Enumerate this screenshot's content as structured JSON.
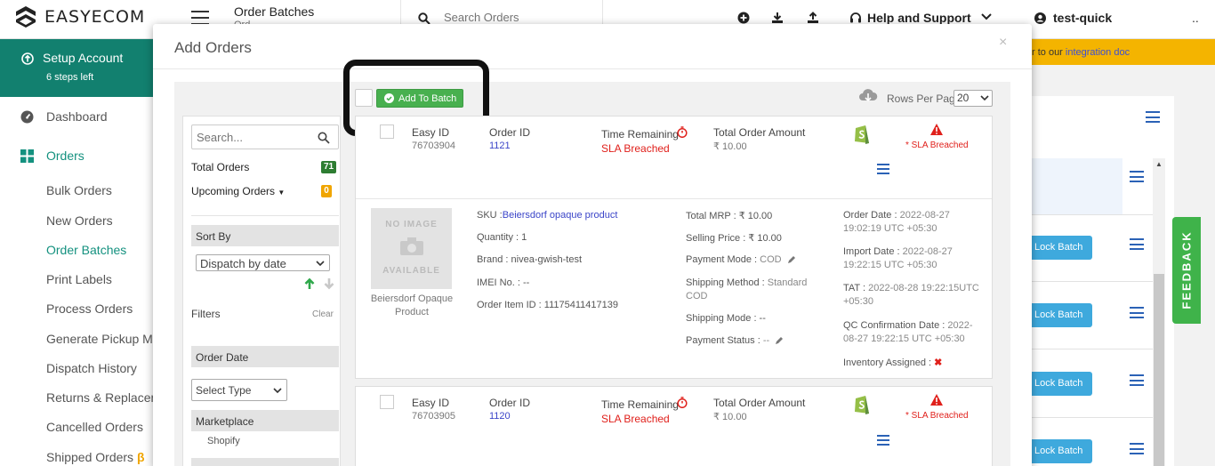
{
  "header": {
    "brand": "EASYECOM",
    "page_title": "Order Batches",
    "page_sub": "Ord",
    "search_placeholder": "Search Orders",
    "help_label": "Help and Support",
    "user_name": "test-quick",
    "more": "..",
    "icons": [
      "plus-circle-icon",
      "download-icon",
      "upload-icon",
      "headset-icon",
      "chevron-down-icon",
      "user-icon"
    ]
  },
  "sidebar": {
    "setup_title": "Setup Account",
    "setup_sub": "6 steps left",
    "dashboard": "Dashboard",
    "orders": "Orders",
    "sub_items": [
      "Bulk Orders",
      "New Orders",
      "Order Batches",
      "Print Labels",
      "Process Orders",
      "Generate Pickup Man",
      "Dispatch History",
      "Returns & Replaceme",
      "Cancelled Orders",
      "Shipped Orders"
    ],
    "shipped_badge": "β",
    "active_sub": "Order Batches"
  },
  "background": {
    "banner_prefix": "r to our ",
    "banner_link": "integration doc",
    "lock_batch_label": "Lock Batch",
    "feedback_label": "FEEDBACK",
    "colors": {
      "accent": "#12806f",
      "banner": "#f4b400",
      "lock": "#3ea9dd",
      "feedback": "#3fb34a"
    }
  },
  "modal": {
    "title": "Add Orders",
    "close": "×",
    "add_to_batch": "Add To Batch",
    "rows_per_page_label": "Rows Per Page",
    "rows_per_page_value": "20",
    "filters": {
      "search_placeholder": "Search...",
      "total_orders_label": "Total Orders",
      "total_orders_count": "71",
      "upcoming_orders_label": "Upcoming Orders",
      "upcoming_orders_count": "0",
      "sort_by_label": "Sort By",
      "sort_by_value": "Dispatch by date",
      "filters_label": "Filters",
      "clear_label": "Clear",
      "order_date_label": "Order Date",
      "select_type_value": "Select Type",
      "marketplace_label": "Marketplace",
      "marketplace_option": "Shopify"
    },
    "column_labels": {
      "easy_id": "Easy ID",
      "order_id": "Order ID",
      "time_remaining": "Time Remaining",
      "total_amount": "Total Order Amount",
      "sla_breached": "SLA Breached",
      "sla_flag": "* SLA Breached"
    },
    "orders": [
      {
        "easy_id": "76703904",
        "order_id": "1121",
        "amount": "₹ 10.00",
        "detail": {
          "image_text_top": "NO IMAGE",
          "image_text_bottom": "AVAILABLE",
          "product_caption": "Beiersdorf Opaque Product",
          "sku_label": "SKU :",
          "sku_value": "Beiersdorf opaque product",
          "quantity": "Quantity : 1",
          "brand": "Brand : nivea-gwish-test",
          "imei": "IMEI No. : --",
          "order_item_id": "Order Item ID : 11175411417139",
          "total_mrp": "Total MRP : ₹ 10.00",
          "selling_price": "Selling Price : ₹ 10.00",
          "payment_mode_label": "Payment Mode :",
          "payment_mode_value": "COD",
          "shipping_method_label": "Shipping Method :",
          "shipping_method_value_1": "Standard",
          "shipping_method_value_2": "COD",
          "shipping_mode": "Shipping Mode : --",
          "payment_status_label": "Payment Status :",
          "payment_status_value": "--",
          "order_date_label": "Order Date :",
          "order_date_value_1": "2022-08-27",
          "order_date_value_2": "19:02:19 UTC +05:30",
          "import_date_label": "Import Date :",
          "import_date_value_1": "2022-08-27",
          "import_date_value_2": "19:22:15 UTC +05:30",
          "tat_label": "TAT :",
          "tat_value_1": "2022-08-28 19:22:15UTC",
          "tat_value_2": "+05:30",
          "qc_label": "QC Confirmation Date :",
          "qc_value_1": "2022-",
          "qc_value_2": "08-27 19:22:15 UTC +05:30",
          "inventory_label": "Inventory Assigned :",
          "inventory_value": "✖"
        }
      },
      {
        "easy_id": "76703905",
        "order_id": "1120",
        "amount": "₹ 10.00"
      }
    ]
  }
}
